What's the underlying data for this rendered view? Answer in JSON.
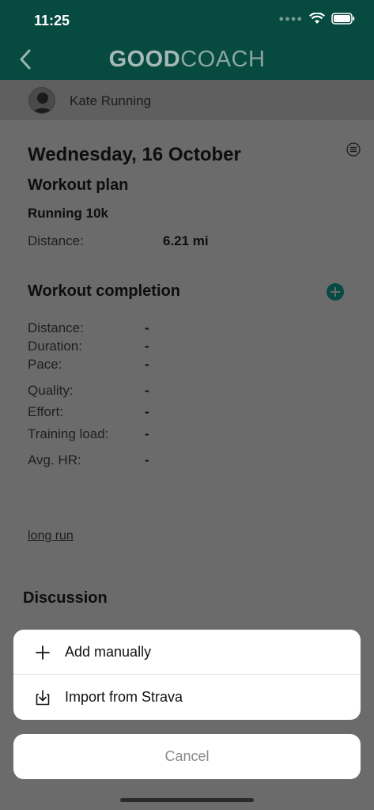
{
  "status_bar": {
    "time": "11:25"
  },
  "header": {
    "brand_bold": "GOOD",
    "brand_light": "COACH"
  },
  "athlete": {
    "name": "Kate Running"
  },
  "workout": {
    "date": "Wednesday, 16 October",
    "plan_heading": "Workout plan",
    "plan_name": "Running 10k",
    "distance_label": "Distance:",
    "distance_value": "6.21 mi"
  },
  "completion": {
    "heading": "Workout completion",
    "stats": [
      {
        "label": "Distance:",
        "value": "-"
      },
      {
        "label": "Duration:",
        "value": "-"
      },
      {
        "label": "Pace:",
        "value": "-"
      },
      {
        "label": "Quality:",
        "value": "-"
      },
      {
        "label": "Effort:",
        "value": "-"
      },
      {
        "label": "Training load:",
        "value": "-"
      },
      {
        "label": "Avg. HR:",
        "value": "-"
      }
    ]
  },
  "tag": "long run",
  "discussion_heading": "Discussion",
  "action_sheet": {
    "items": [
      {
        "label": "Add manually",
        "icon": "plus-icon"
      },
      {
        "label": "Import from Strava",
        "icon": "import-icon"
      }
    ],
    "cancel": "Cancel"
  },
  "colors": {
    "brand_dark": "#064a40",
    "overlay": "#6b6b6b"
  }
}
